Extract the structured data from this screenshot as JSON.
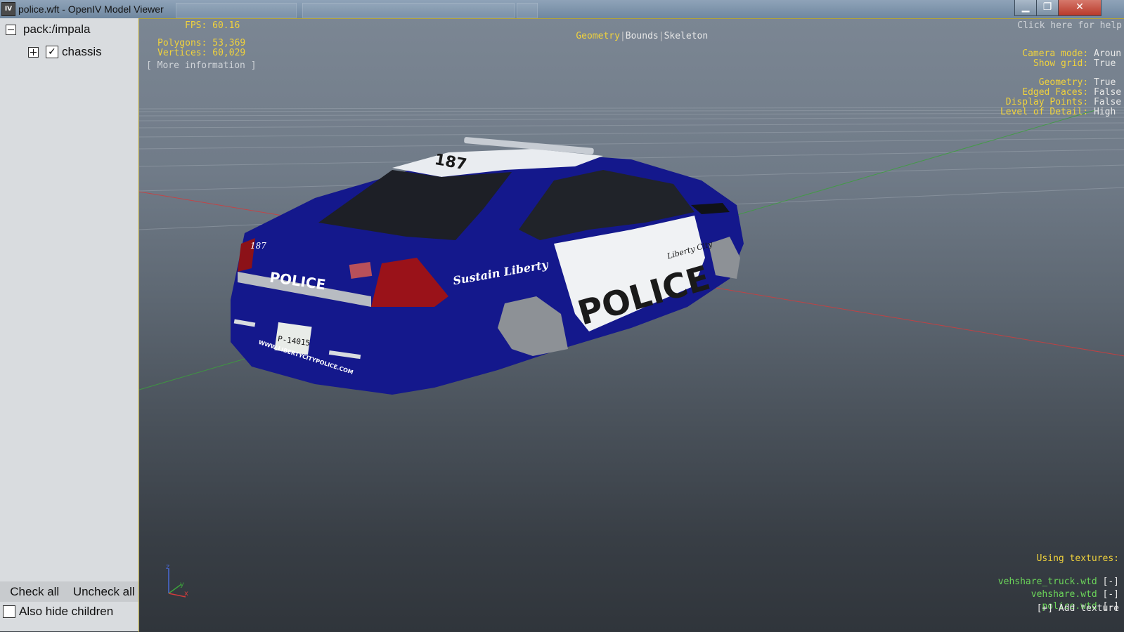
{
  "window": {
    "title": "police.wft - OpenIV Model Viewer",
    "icon_label": "IV",
    "minimize": "▁",
    "maximize": "❐",
    "close": "✕"
  },
  "tree": {
    "root": "pack:/impala",
    "child": "chassis",
    "child_checked": "✓"
  },
  "left_bottom": {
    "check_all": "Check all",
    "uncheck_all": "Uncheck all",
    "also_hide": "Also hide children"
  },
  "hud": {
    "fps": "FPS: 60.16",
    "polygons": "Polygons: 53,369",
    "vertices": "Vertices: 60,029",
    "more_info": "[ More information ]",
    "tabs": [
      "Geometry",
      "Bounds",
      "Skeleton"
    ],
    "help": "Click here for help",
    "settings": [
      {
        "label": "Camera mode:",
        "value": "Aroun"
      },
      {
        "label": "Show grid:",
        "value": "True"
      },
      {
        "label": "Geometry:",
        "value": "True"
      },
      {
        "label": "Edged Faces:",
        "value": "False"
      },
      {
        "label": "Display Points:",
        "value": "False"
      },
      {
        "label": "Level of Detail:",
        "value": "High"
      }
    ],
    "textures_title": "Using textures:",
    "textures": [
      {
        "name": "vehshare_truck.wtd",
        "remove": "[-]"
      },
      {
        "name": "vehshare.wtd",
        "remove": "[-]"
      },
      {
        "name": "police.wtd",
        "remove": "[-]"
      }
    ],
    "add_texture": "[+] Add texture"
  },
  "car": {
    "roof_number": "187",
    "trunk_text": "POLICE",
    "side_text": "POLICE",
    "slogan": "Sustain Liberty",
    "city": "Liberty City",
    "plate": "P-14015",
    "website": "WWW.LIBERTYCITYPOLICE.COM",
    "unit_number": "187"
  },
  "axis": {
    "x": "x",
    "y": "y",
    "z": "z"
  },
  "colors": {
    "hud_yellow": "#f0d23c",
    "hud_green": "#6cd65a",
    "car_blue": "#14188c",
    "axis_red": "#d23c3c",
    "axis_green": "#3ca03c"
  }
}
